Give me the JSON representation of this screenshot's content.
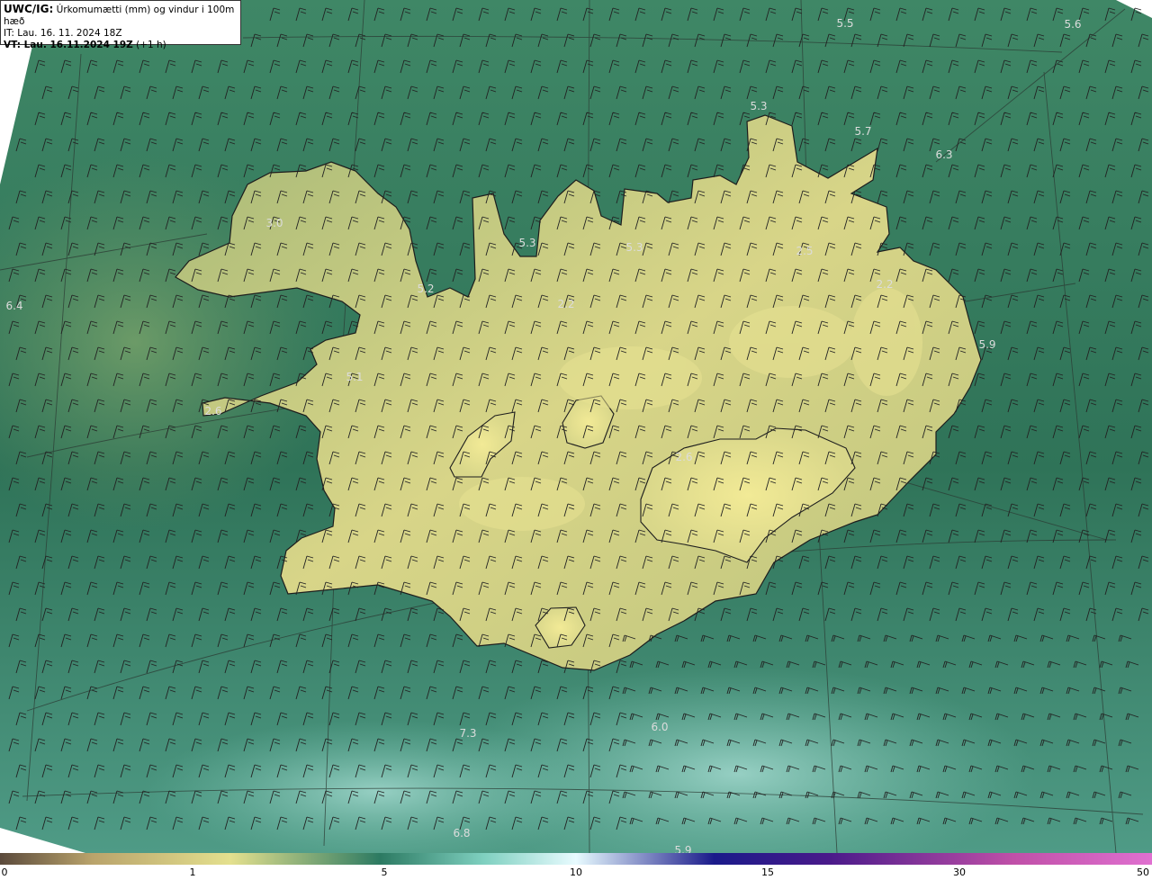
{
  "header": {
    "code": "UWC/IG:",
    "title": "Úrkomumætti (mm) og vindur i 100m hæð",
    "it": "IT: Lau. 16. 11. 2024 18Z",
    "vt_bold": "VT: Lau. 16.11.2024 19Z",
    "vt_rest": " (+1 h)"
  },
  "value_labels": [
    {
      "text": "5.5"
    },
    {
      "text": "5.6"
    },
    {
      "text": "5.3"
    },
    {
      "text": "5.7"
    },
    {
      "text": "6.3"
    },
    {
      "text": "3.0"
    },
    {
      "text": "5.3"
    },
    {
      "text": "5.3"
    },
    {
      "text": "2.5"
    },
    {
      "text": "5.2"
    },
    {
      "text": "2.2"
    },
    {
      "text": "2.2"
    },
    {
      "text": "6.4"
    },
    {
      "text": "5.9"
    },
    {
      "text": "5.1"
    },
    {
      "text": "2.6"
    },
    {
      "text": "7.3"
    },
    {
      "text": "6.0"
    },
    {
      "text": "6.8"
    },
    {
      "text": "5.9"
    },
    {
      "text": "2.6"
    }
  ],
  "colorbar": {
    "ticks": [
      "0",
      "1",
      "5",
      "10",
      "15",
      "30",
      "50"
    ],
    "colors": [
      "#5b4a3c",
      "#b9a36b",
      "#e4e08e",
      "#2c7a62",
      "#7fd0c0",
      "#e8fbff",
      "#1a1a8a",
      "#4a1a8a",
      "#c050a8",
      "#e070d0"
    ]
  },
  "palette": {
    "sea_dark": "#2e6e56",
    "sea_mid": "#3f8a6c",
    "land_low": "#8aa66a",
    "land_high": "#e6e08e",
    "sea_light": "#79c3b0"
  }
}
